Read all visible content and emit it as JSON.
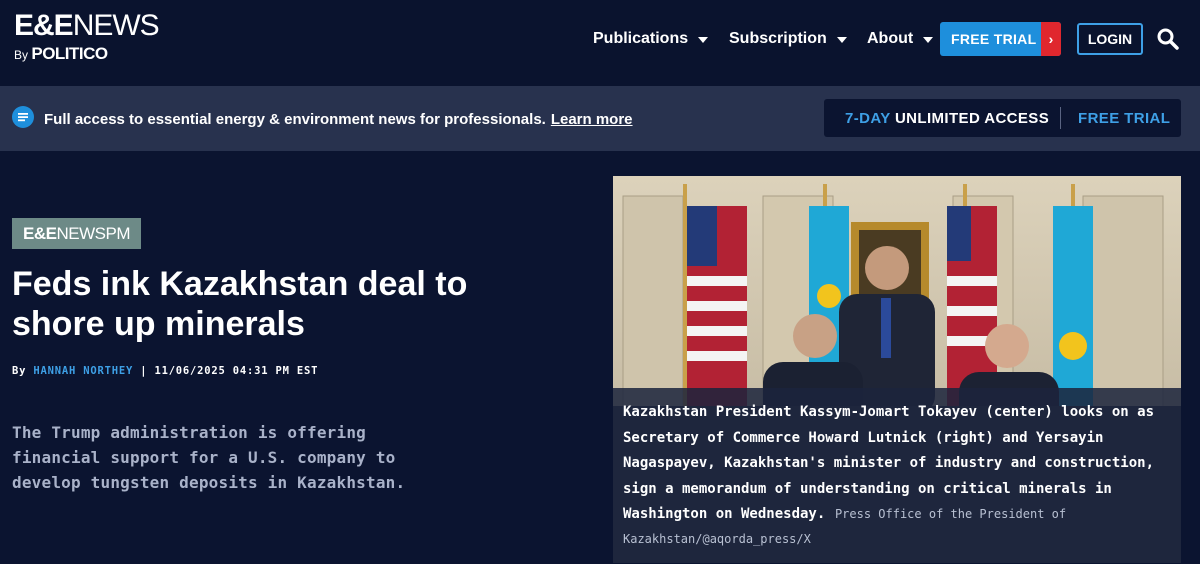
{
  "header": {
    "logo": {
      "ee": "E&E",
      "news": "NEWS",
      "by": "By",
      "politico": "POLITICO"
    },
    "nav": [
      {
        "label": "Publications"
      },
      {
        "label": "Subscription"
      },
      {
        "label": "About"
      }
    ],
    "free_trial_label": "FREE TRIAL",
    "free_trial_arrow": "›",
    "login_label": "LOGIN"
  },
  "banner": {
    "text": "Full access to essential energy & environment news for professionals.",
    "link": "Learn more",
    "access_days": "7-DAY",
    "access_label": "UNLIMITED ACCESS",
    "access_trial": "FREE TRIAL"
  },
  "article": {
    "badge_ee": "E&E",
    "badge_rest": "NEWSPM",
    "headline": "Feds ink Kazakhstan deal to shore up minerals",
    "by": "By",
    "author": "HANNAH NORTHEY",
    "date": "| 11/06/2025 04:31 PM EST",
    "summary": "The Trump administration is offering financial support for a U.S. company to develop tungsten deposits in Kazakhstan.",
    "caption": "Kazakhstan President Kassym-Jomart Tokayev (center) looks on as Secretary of Commerce Howard Lutnick (right) and Yersayin Nagaspayev, Kazakhstan's minister of industry and construction, sign a memorandum of understanding on critical minerals in Washington on Wednesday.",
    "credit": "Press Office of the President of Kazakhstan/@aqorda_press/X"
  },
  "colors": {
    "navy": "#0a132e",
    "banner": "#28324e",
    "accent": "#1e8fdc",
    "red": "#e0272e",
    "badge": "#6d8a87"
  }
}
